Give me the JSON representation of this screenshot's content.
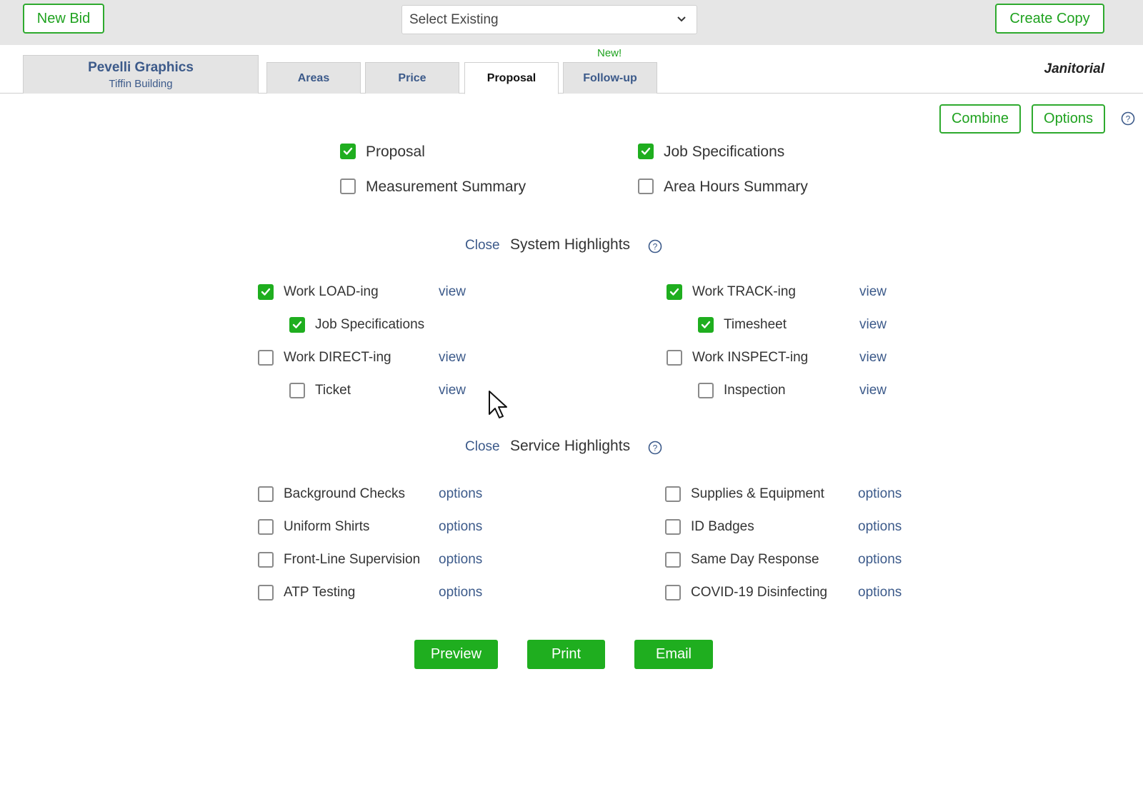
{
  "header": {
    "new_bid": "New Bid",
    "select_existing": "Select Existing",
    "create_copy": "Create Copy"
  },
  "client": {
    "name": "Pevelli Graphics",
    "building": "Tiffin Building"
  },
  "tabs": [
    {
      "label": "Areas",
      "active": false
    },
    {
      "label": "Price",
      "active": false
    },
    {
      "label": "Proposal",
      "active": true
    },
    {
      "label": "Follow-up",
      "active": false
    }
  ],
  "new_badge": "New!",
  "service_type": "Janitorial",
  "actions": {
    "combine": "Combine",
    "options": "Options"
  },
  "documents": [
    {
      "label": "Proposal",
      "checked": true
    },
    {
      "label": "Job Specifications",
      "checked": true
    },
    {
      "label": "Measurement Summary",
      "checked": false
    },
    {
      "label": "Area Hours Summary",
      "checked": false
    }
  ],
  "system_highlights": {
    "close": "Close",
    "title": "System Highlights",
    "items": [
      {
        "label": "Work LOAD-ing",
        "checked": true,
        "link": "view"
      },
      {
        "label": "Work TRACK-ing",
        "checked": true,
        "link": "view"
      },
      {
        "label": "Job Specifications",
        "checked": true,
        "link": ""
      },
      {
        "label": "Timesheet",
        "checked": true,
        "link": "view"
      },
      {
        "label": "Work DIRECT-ing",
        "checked": false,
        "link": "view"
      },
      {
        "label": "Work INSPECT-ing",
        "checked": false,
        "link": "view"
      },
      {
        "label": "Ticket",
        "checked": false,
        "link": "view"
      },
      {
        "label": "Inspection",
        "checked": false,
        "link": "view"
      }
    ]
  },
  "service_highlights": {
    "close": "Close",
    "title": "Service Highlights",
    "items": [
      {
        "label": "Background Checks",
        "checked": false,
        "link": "options"
      },
      {
        "label": "Supplies & Equipment",
        "checked": false,
        "link": "options"
      },
      {
        "label": "Uniform Shirts",
        "checked": false,
        "link": "options"
      },
      {
        "label": "ID Badges",
        "checked": false,
        "link": "options"
      },
      {
        "label": "Front-Line Supervision",
        "checked": false,
        "link": "options"
      },
      {
        "label": "Same Day Response",
        "checked": false,
        "link": "options"
      },
      {
        "label": "ATP Testing",
        "checked": false,
        "link": "options"
      },
      {
        "label": "COVID-19 Disinfecting",
        "checked": false,
        "link": "options"
      }
    ]
  },
  "footer": {
    "preview": "Preview",
    "print": "Print",
    "email": "Email"
  },
  "colors": {
    "accent_green": "#1fae1f",
    "link_blue": "#3c5a8a"
  }
}
